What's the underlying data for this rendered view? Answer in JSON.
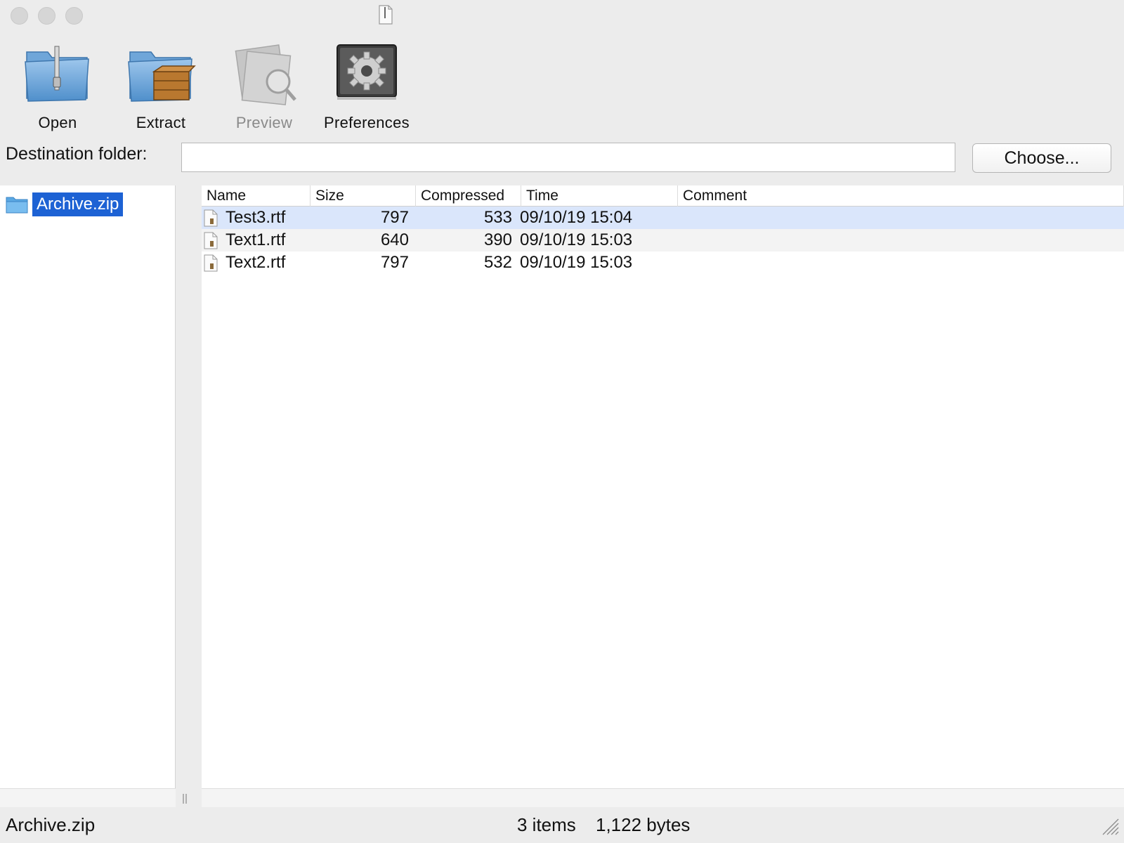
{
  "window": {
    "traffic_lights": [
      "close",
      "minimize",
      "zoom"
    ],
    "title_icon": "document-icon"
  },
  "toolbar": {
    "items": [
      {
        "label": "Open",
        "icon": "zip-folder-icon",
        "enabled": true
      },
      {
        "label": "Extract",
        "icon": "folder-box-icon",
        "enabled": true
      },
      {
        "label": "Preview",
        "icon": "preview-icon",
        "enabled": false
      },
      {
        "label": "Preferences",
        "icon": "gear-icon",
        "enabled": true
      }
    ]
  },
  "destination": {
    "label": "Destination folder:",
    "value": "",
    "choose_label": "Choose..."
  },
  "sidebar": {
    "items": [
      {
        "label": "Archive.zip",
        "icon": "folder-icon",
        "selected": true
      }
    ]
  },
  "table": {
    "columns": [
      "Name",
      "Size",
      "Compressed",
      "Time",
      "Comment"
    ],
    "rows": [
      {
        "name": "Test3.rtf",
        "size": "797",
        "compressed": "533",
        "time": "09/10/19 15:04",
        "comment": "",
        "selected": true
      },
      {
        "name": "Text1.rtf",
        "size": "640",
        "compressed": "390",
        "time": "09/10/19 15:03",
        "comment": ""
      },
      {
        "name": "Text2.rtf",
        "size": "797",
        "compressed": "532",
        "time": "09/10/19 15:03",
        "comment": ""
      }
    ]
  },
  "status": {
    "archive": "Archive.zip",
    "items": "3 items",
    "bytes": "1,122 bytes"
  },
  "colors": {
    "selection": "#1d62d4",
    "row_selected": "#dae6fb",
    "window_bg": "#ececec"
  }
}
